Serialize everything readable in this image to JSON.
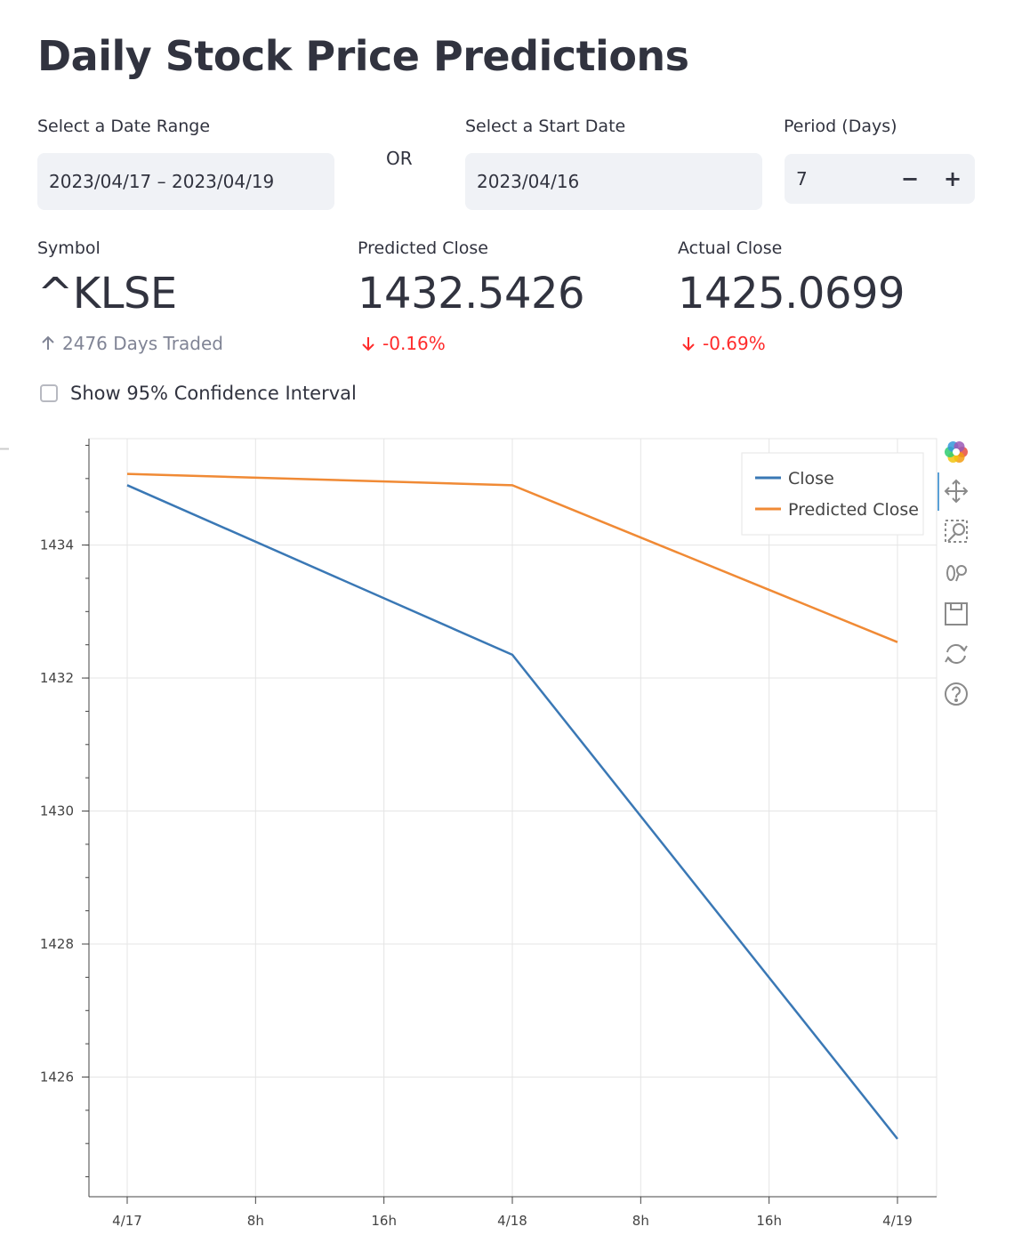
{
  "page": {
    "title": "Daily Stock Price Predictions"
  },
  "inputs": {
    "date_range": {
      "label": "Select a Date Range",
      "value": "2023/04/17 – 2023/04/19"
    },
    "or_text": "OR",
    "start_date": {
      "label": "Select a Start Date",
      "value": "2023/04/16"
    },
    "period": {
      "label": "Period (Days)",
      "value": "7",
      "minus": "−",
      "plus": "+"
    }
  },
  "metrics": {
    "symbol": {
      "label": "Symbol",
      "value": "^KLSE",
      "delta": "2476 Days Traded",
      "delta_direction": "up"
    },
    "predicted_close": {
      "label": "Predicted Close",
      "value": "1432.5426",
      "delta": "-0.16%",
      "delta_direction": "down"
    },
    "actual_close": {
      "label": "Actual Close",
      "value": "1425.0699",
      "delta": "-0.69%",
      "delta_direction": "down"
    }
  },
  "options": {
    "confidence_interval": {
      "label": "Show 95% Confidence Interval",
      "checked": false
    }
  },
  "colors": {
    "close": "#3a78b5",
    "predicted_close": "#f08a35",
    "negative": "#ff2b2b",
    "neutral": "#808495"
  },
  "toolbar": {
    "icons": [
      "bokeh-logo-icon",
      "pan-icon",
      "box-zoom-icon",
      "wheel-zoom-icon",
      "save-icon",
      "reset-icon",
      "help-icon"
    ]
  },
  "chart_data": {
    "type": "line",
    "title": "",
    "xlabel": "",
    "ylabel": "",
    "x": [
      "2023-04-17",
      "2023-04-18",
      "2023-04-19"
    ],
    "x_ticks": [
      "4/17",
      "8h",
      "16h",
      "4/18",
      "8h",
      "16h",
      "4/19"
    ],
    "y_ticks": [
      "1426",
      "1428",
      "1430",
      "1432",
      "1434"
    ],
    "ylim": [
      1424.2,
      1435.6
    ],
    "grid": true,
    "legend_position": "top-right",
    "series": [
      {
        "name": "Close",
        "values": [
          1434.9,
          1432.35,
          1425.07
        ]
      },
      {
        "name": "Predicted Close",
        "values": [
          1435.07,
          1434.9,
          1432.54
        ]
      }
    ]
  }
}
